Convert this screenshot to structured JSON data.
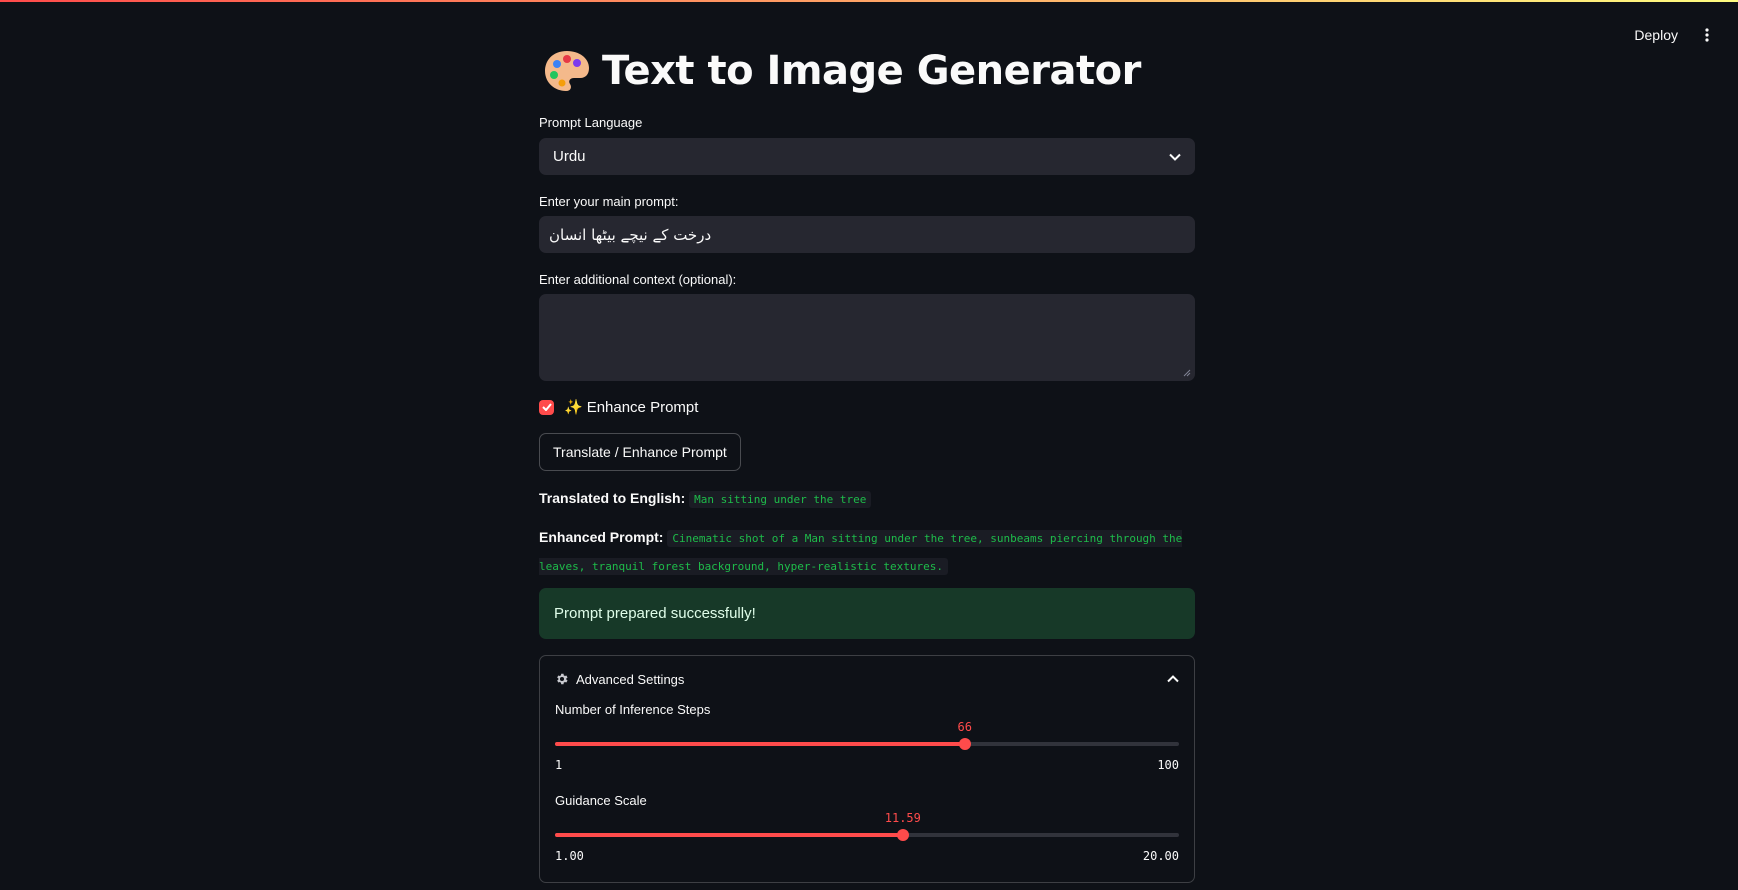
{
  "header": {
    "deploy_label": "Deploy",
    "menu_icon": "vertical-ellipsis-icon"
  },
  "page": {
    "title": "Text to Image Generator",
    "title_icon": "palette-icon"
  },
  "language": {
    "label": "Prompt Language",
    "selected": "Urdu"
  },
  "main_prompt": {
    "label": "Enter your main prompt:",
    "value": "درخت کے نیچے بیٹھا انسان"
  },
  "context": {
    "label": "Enter additional context (optional):",
    "value": ""
  },
  "enhance": {
    "icon": "✨",
    "label": "Enhance Prompt",
    "checked": true
  },
  "translate_button": {
    "label": "Translate / Enhance Prompt"
  },
  "translated": {
    "label": "Translated to English:",
    "value": "Man sitting under the tree"
  },
  "enhanced": {
    "label": "Enhanced Prompt:",
    "value": "Cinematic shot of a Man sitting under the tree, sunbeams piercing through the leaves, tranquil forest background, hyper-realistic textures."
  },
  "success": {
    "message": "Prompt prepared successfully!"
  },
  "advanced": {
    "title": "Advanced Settings",
    "icon": "gear-icon",
    "expanded": true,
    "steps": {
      "label": "Number of Inference Steps",
      "value": "66",
      "min": "1",
      "max": "100",
      "fraction": 0.6566
    },
    "guidance": {
      "label": "Guidance Scale",
      "value": "11.59",
      "min": "1.00",
      "max": "20.00",
      "fraction": 0.5574
    }
  },
  "colors": {
    "background": "#0e1117",
    "accent": "#ff4b4b",
    "input_bg": "#262730",
    "code_green": "#1ebc4a",
    "success_bg": "#173928"
  }
}
